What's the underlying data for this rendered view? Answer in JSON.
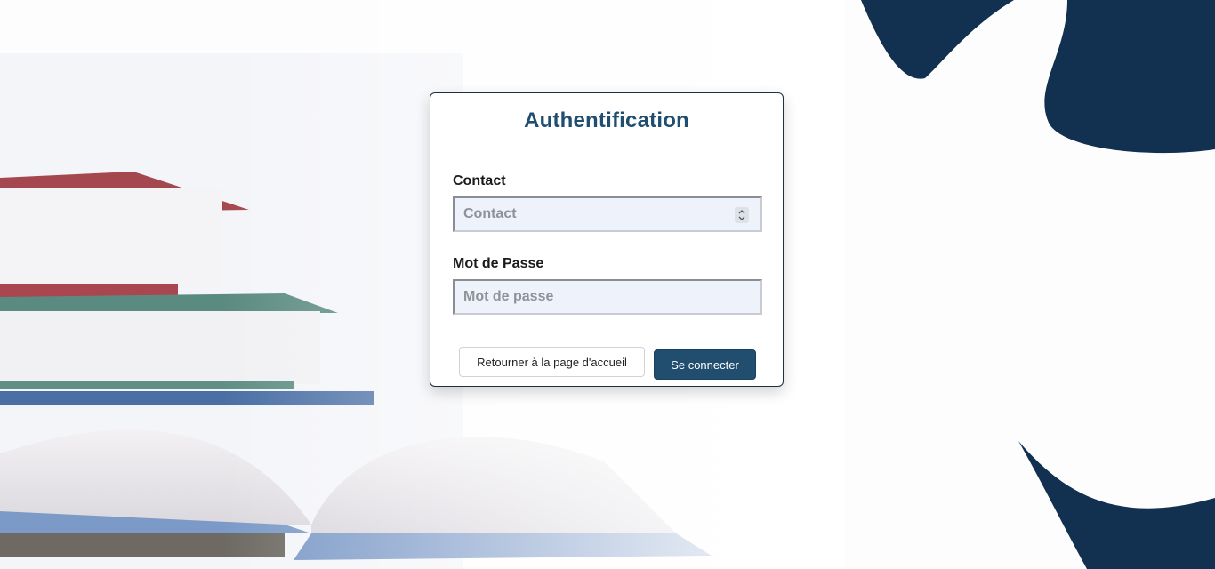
{
  "card": {
    "title": "Authentification"
  },
  "form": {
    "contact_label": "Contact",
    "contact_placeholder": "Contact",
    "password_label": "Mot de Passe",
    "password_placeholder": "Mot de passe"
  },
  "actions": {
    "back_label": "Retourner à la page d'accueil",
    "login_label": "Se connecter"
  },
  "colors": {
    "brand_dark": "#12304f",
    "title": "#1f4e70",
    "primary_button": "#214d6f"
  },
  "icons": {
    "number_spinner": "chevron-up-down-icon"
  }
}
